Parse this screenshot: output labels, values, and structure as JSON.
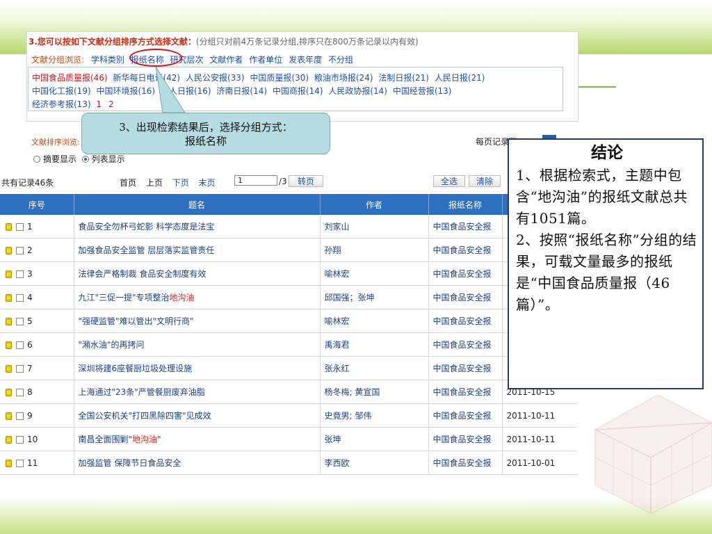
{
  "panel": {
    "title": "3.您可以按如下文献分组排序方式选择文献：",
    "title_note": "(分组只对前4万条记录分组,排序只在800万条记录以内有效)",
    "group_label": "文献分组浏览:",
    "group_options": [
      "学科类别",
      "报纸名称",
      "研究层次",
      "文献作者",
      "作者单位",
      "发表年度",
      "不分组"
    ],
    "papers": [
      "中国食品质量报(46)",
      "新华每日电讯(42)",
      "人民公安报(33)",
      "中国质量报(30)",
      "粮油市场报(24)",
      "法制日报(21)",
      "人民日报(21)",
      "中国化工报(19)",
      "中国环境报(16)",
      "工人日报(16)",
      "济南日报(14)",
      "中国商报(14)",
      "人民政协报(14)",
      "中国经营报(13)",
      "经济参考报(13)"
    ],
    "pages": [
      "1",
      "2"
    ],
    "sort_label": "文献排序浏览:",
    "display_options": [
      "摘要显示",
      "列表显示"
    ],
    "per_page_label": "每页记录数:"
  },
  "callout": {
    "text_line1": "3、出现检索结果后，选择分组方式：",
    "text_line2": "报纸名称"
  },
  "toolbar": {
    "total": "共有记录46条",
    "first": "首页",
    "prev": "上页",
    "next": "下页",
    "last": "末页",
    "page_value": "1",
    "page_total": "/3",
    "go": "转页",
    "select_all": "全选",
    "clear": "清除"
  },
  "table": {
    "headers": [
      "序号",
      "题名",
      "作者",
      "报纸名称",
      ""
    ],
    "rows": [
      {
        "no": "1",
        "title": "食品安全勿杯弓蛇影 科学态度是法宝",
        "author": "刘家山",
        "paper": "中国食品安全报",
        "date": ""
      },
      {
        "no": "2",
        "title": "加强食品安全监管 层层落实监管责任",
        "author": "孙翔",
        "paper": "中国食品安全报",
        "date": ""
      },
      {
        "no": "3",
        "title": "法律会严格制裁 食品安全制度有效",
        "author": "喻林宏",
        "paper": "中国食品安全报",
        "date": ""
      },
      {
        "no": "4",
        "title_pre": "九江\"三促一提\"专项整治",
        "title_kw": "地沟油",
        "title_post": "",
        "author": "邱国强；张坤",
        "paper": "中国食品安全报",
        "date": ""
      },
      {
        "no": "5",
        "title": "\"强硬监管\"难以管出\"文明行商\"",
        "author": "喻林宏",
        "paper": "中国食品安全报",
        "date": ""
      },
      {
        "no": "6",
        "title": "\"潲水油\"的再拷问",
        "author": "禹海君",
        "paper": "中国食品安全报",
        "date": ""
      },
      {
        "no": "7",
        "title": "深圳将建6座餐厨垃圾处理设施",
        "author": "张永红",
        "paper": "中国食品安全报",
        "date": ""
      },
      {
        "no": "8",
        "title": "上海通过\"23条\"严管餐厨废弃油脂",
        "author": "杨冬梅; 黄宣国",
        "paper": "中国食品安全报",
        "date": "2011-10-15"
      },
      {
        "no": "9",
        "title": "全国公安机关\"打四黑除四害\"见成效",
        "author": "史竟男; 邹伟",
        "paper": "中国食品安全报",
        "date": "2011-10-11"
      },
      {
        "no": "10",
        "title_pre": "南昌全面围剿\"",
        "title_kw": "地沟油",
        "title_post": "\"",
        "author": "张坤",
        "paper": "中国食品安全报",
        "date": "2011-10-11"
      },
      {
        "no": "11",
        "title": "加强监管 保障节日食品安全",
        "author": "李西欧",
        "paper": "中国食品安全报",
        "date": "2011-10-01"
      }
    ]
  },
  "conclusion": {
    "title": "结论",
    "p1": "1、根据检索式，主题中包含“地沟油”的报纸文献总共有1051篇。",
    "p2": "2、按照“报纸名称”分组的结果，可载文量最多的报纸是“中国食品质量报（46篇）”。"
  },
  "colors": {
    "header_blue": "#2f6fbf",
    "link_blue": "#1f4fb0",
    "highlight_red": "#d31212",
    "callout_bg": "#b5dce0",
    "slide_green": "#b7d86c"
  },
  "icons": {
    "row_note": "note-icon",
    "row_checkbox": "checkbox"
  }
}
